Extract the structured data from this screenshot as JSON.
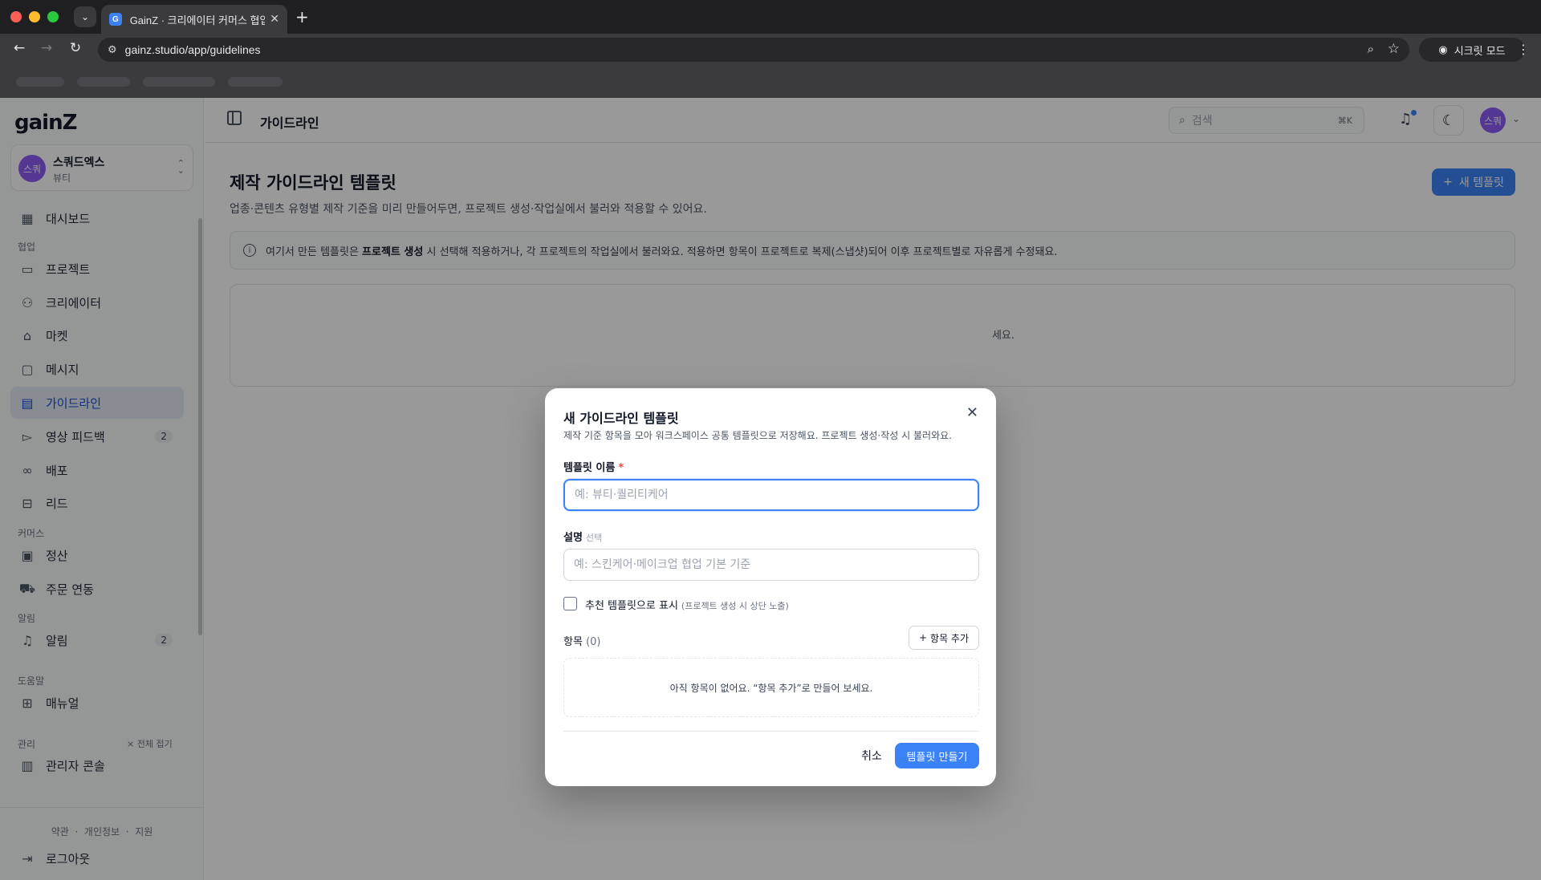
{
  "browser": {
    "tab_title": "GainZ · 크리에이터 커머스 협업 O",
    "favicon_letter": "G",
    "url": "gainz.studio/app/guidelines",
    "incognito_label": "시크릿 모드"
  },
  "sidebar": {
    "logo": "gainZ",
    "workspace": {
      "avatar": "스쿼",
      "name": "스쿼드엑스",
      "category": "뷰티"
    },
    "sections": {
      "collab": "협업",
      "commerce": "커머스",
      "alerts": "알림",
      "help": "도움말",
      "admin": "관리"
    },
    "items": {
      "dashboard": "대시보드",
      "projects": "프로젝트",
      "creators": "크리에이터",
      "market": "마켓",
      "messages": "메시지",
      "guidelines": "가이드라인",
      "video_feedback": "영상 피드백",
      "video_feedback_badge": "2",
      "distribution": "배포",
      "leads": "리드",
      "settlement": "정산",
      "order_sync": "주문 연동",
      "notifications": "알림",
      "notifications_badge": "2",
      "manual": "매뉴얼",
      "admin_console": "관리자 콘솔"
    },
    "collapse_all": "전체 접기",
    "footer": {
      "terms": "약관",
      "privacy": "개인정보",
      "support": "지원",
      "separator": "·"
    },
    "logout": "로그아웃"
  },
  "topbar": {
    "title": "가이드라인",
    "search_placeholder": "검색",
    "search_shortcut": "⌘K",
    "user_avatar": "스쿼"
  },
  "main": {
    "title": "제작 가이드라인 템플릿",
    "subtitle": "업종·콘텐츠 유형별 제작 기준을 미리 만들어두면, 프로젝트 생성·작업실에서 불러와 적용할 수 있어요.",
    "new_template_button": "새 템플릿",
    "info_prefix": "여기서 만든 템플릿은",
    "info_bold": "프로젝트 생성",
    "info_suffix": "시 선택해 적용하거나, 각 프로젝트의 작업실에서 불러와요. 적용하면 항목이 프로젝트로 복제(스냅샷)되어 이후 프로젝트별로 자유롭게 수정돼요.",
    "empty_card_text": "세요."
  },
  "modal": {
    "title": "새 가이드라인 템플릿",
    "description": "제작 기준 항목을 모아 워크스페이스 공통 템플릿으로 저장해요. 프로젝트 생성·작성 시 불러와요.",
    "name_label": "템플릿 이름",
    "name_required_mark": "*",
    "name_placeholder": "예: 뷰티·퀄리티케어",
    "name_value": "",
    "desc_label": "설명",
    "desc_optional": "선택",
    "desc_placeholder": "예: 스킨케어·메이크업 협업 기본 기준",
    "desc_value": "",
    "recommend_label": "추천 템플릿으로 표시",
    "recommend_hint": "(프로젝트 생성 시 상단 노출)",
    "recommend_checked": false,
    "items_label": "항목",
    "items_count": "(0)",
    "add_item_button": "항목 추가",
    "items_empty": "아직 항목이 없어요. “항목 추가”로 만들어 보세요.",
    "cancel_button": "취소",
    "create_button": "템플릿 만들기"
  },
  "colors": {
    "accent": "#3b82f6",
    "avatar": "#8b5cf6",
    "active_nav_bg": "#e3e9f6",
    "required": "#ef4444"
  }
}
